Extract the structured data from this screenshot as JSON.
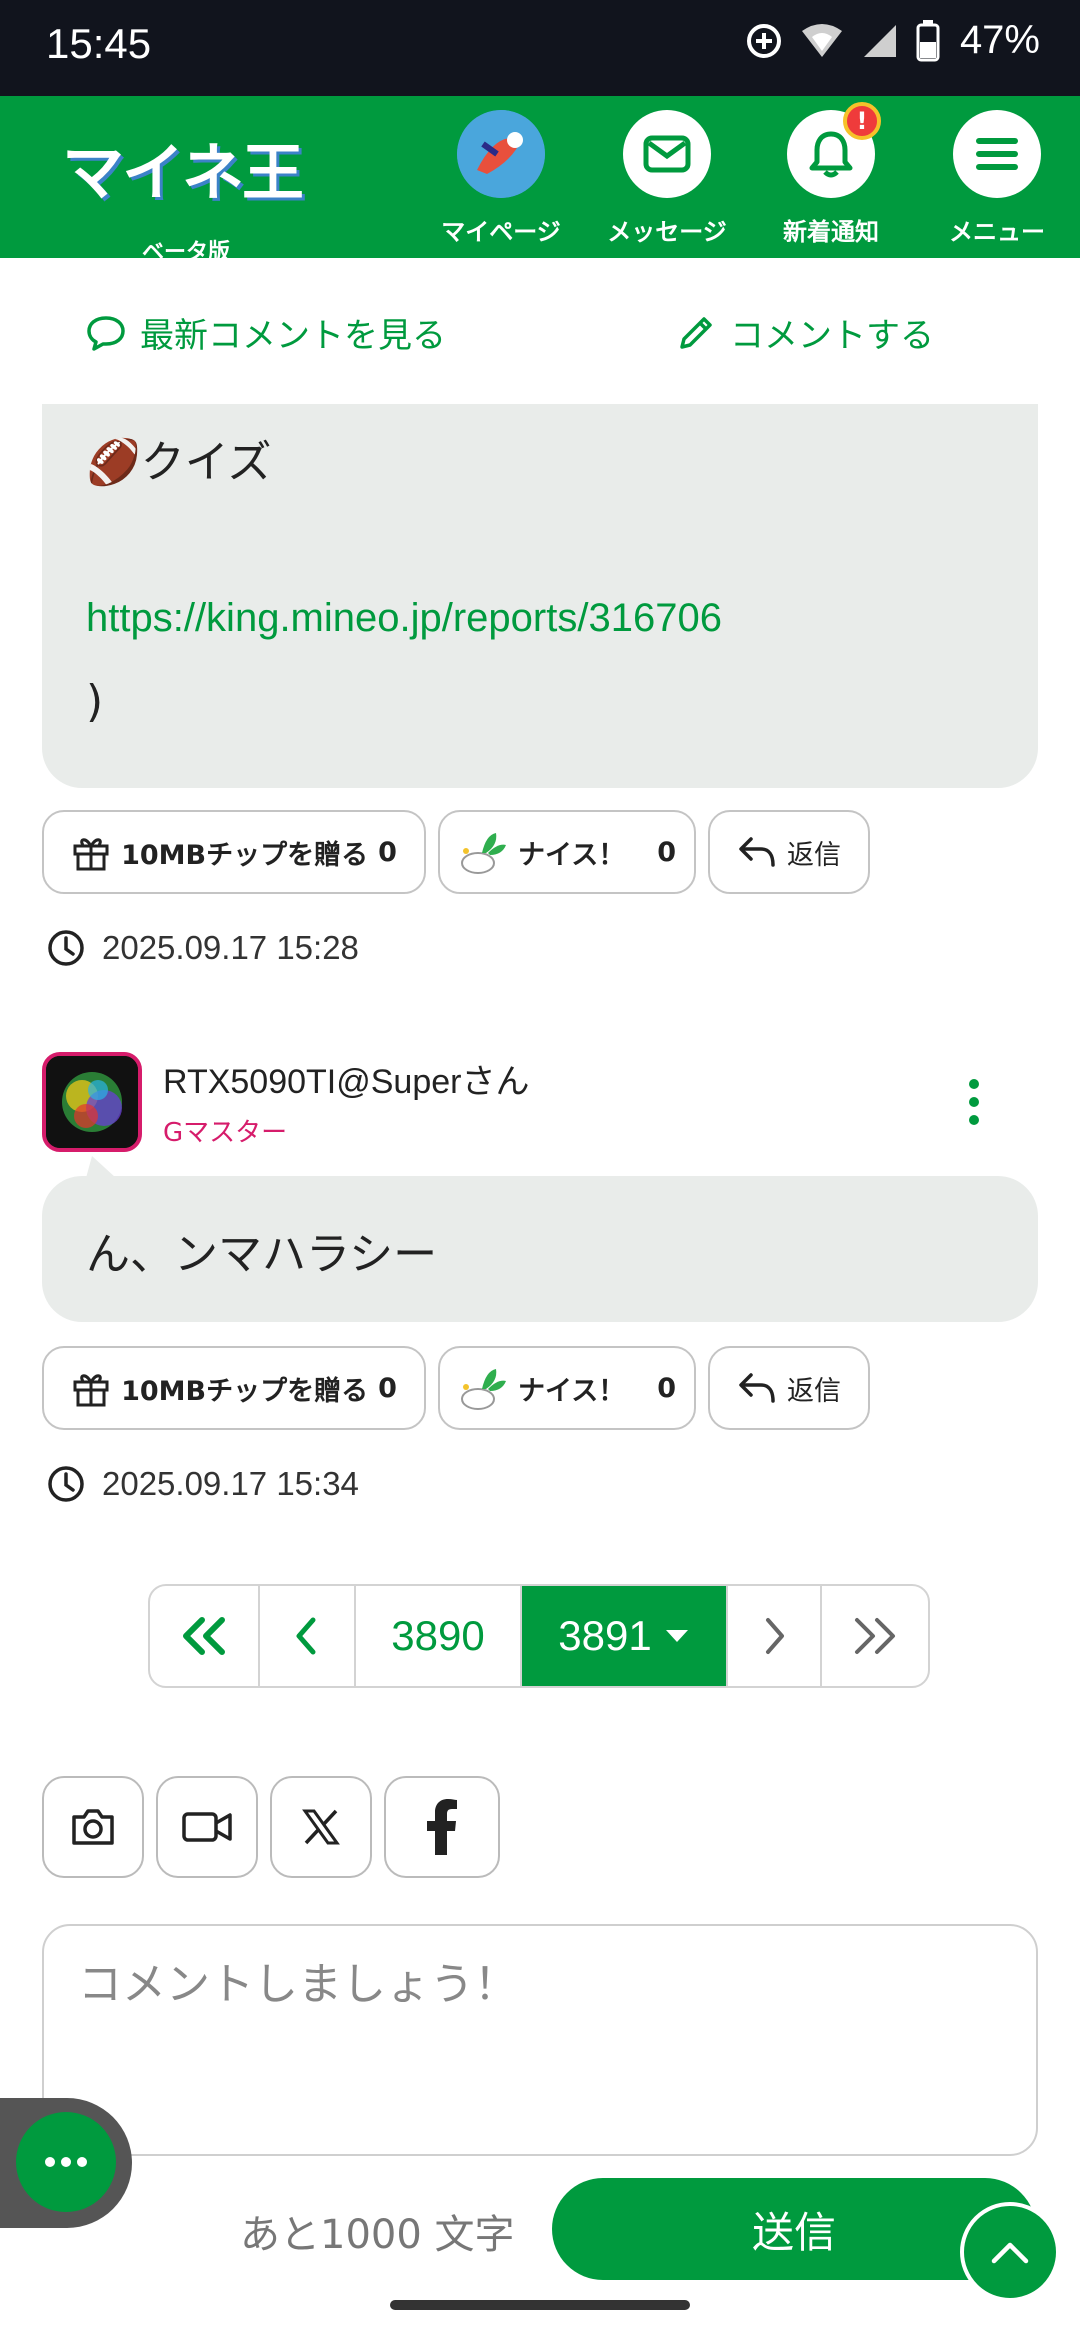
{
  "status_bar": {
    "time": "15:45",
    "battery": "47%"
  },
  "header": {
    "logo_text": "マイネ王",
    "logo_sub": "ベータ版",
    "nav": [
      {
        "label": "マイページ"
      },
      {
        "label": "メッセージ"
      },
      {
        "label": "新着通知",
        "badge": "!"
      },
      {
        "label": "メニュー"
      }
    ]
  },
  "actions": {
    "latest": "最新コメントを見る",
    "comment": "コメントする"
  },
  "comment1": {
    "line1": "🏈クイズ",
    "link": "https://king.mineo.jp/reports/316706",
    "line3": ")",
    "tip_label": "10MBチップを贈る",
    "tip_count": "0",
    "nice_label": "ナイス！",
    "nice_count": "0",
    "reply_label": "返信",
    "time": "2025.09.17 15:28"
  },
  "comment2": {
    "user": "RTX5090TI@Superさん",
    "rank": "Gマスター",
    "text": "ん、ンマハラシー",
    "tip_label": "10MBチップを贈る",
    "tip_count": "0",
    "nice_label": "ナイス！",
    "nice_count": "0",
    "reply_label": "返信",
    "time": "2025.09.17 15:34"
  },
  "pagination": {
    "prev_page": "3890",
    "current_page": "3891"
  },
  "composer": {
    "placeholder": "コメントしましょう！",
    "remaining": "あと1000 文字",
    "send": "送信"
  },
  "colors": {
    "brand_green": "#009a3e",
    "rank_pink": "#d61c6b"
  }
}
